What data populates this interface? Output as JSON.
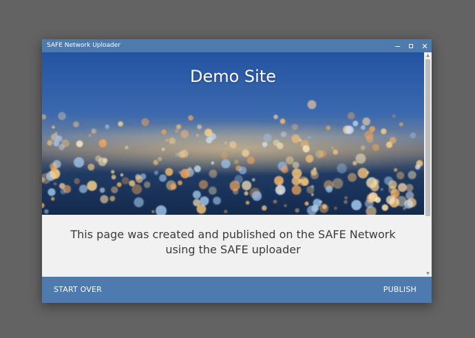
{
  "window": {
    "title": "SAFE Network Uploader"
  },
  "hero": {
    "title": "Demo Site"
  },
  "description": {
    "line1": "This page was created and published on the SAFE Network",
    "line2": "using the SAFE uploader"
  },
  "footer": {
    "start_over_label": "START OVER",
    "publish_label": "PUBLISH"
  },
  "colors": {
    "accent": "#4d7bb0",
    "desktop": "#636363",
    "content_bg": "#f1f1f1",
    "text": "#3a3a3a"
  },
  "icons": {
    "minimize": "minimize-icon",
    "maximize": "maximize-icon",
    "close": "close-icon"
  }
}
